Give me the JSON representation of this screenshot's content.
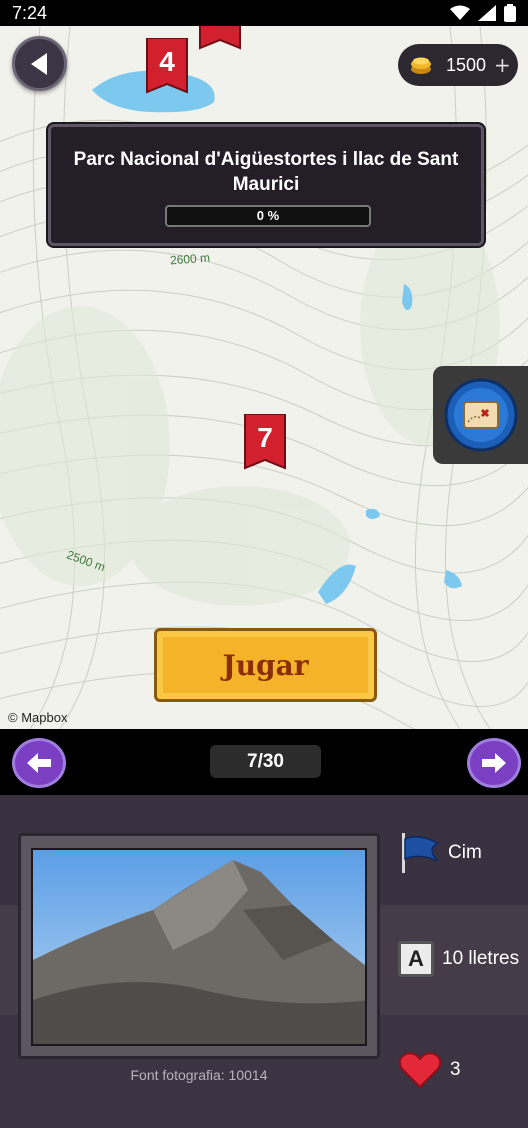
{
  "statusbar": {
    "time": "7:24"
  },
  "coins": {
    "value": "1500",
    "plus": "+"
  },
  "park": {
    "title": "Parc Nacional d'Aigüestortes i llac de Sant Maurici",
    "progress_text": "0 %",
    "progress": 0
  },
  "markers": [
    {
      "number": "4"
    },
    {
      "number": "7"
    }
  ],
  "contours": {
    "label_a": "2600 m",
    "label_b": "2500 m"
  },
  "play_button": {
    "label": "Jugar"
  },
  "attribution": "© Mapbox",
  "pager": {
    "current": "7/30"
  },
  "details": {
    "photo_credit": "Font fotografia: 10014",
    "category": "Cim",
    "letter_box": "A",
    "letters": "10 lletres",
    "lives": "3"
  },
  "colors": {
    "purple_button": "#7b3fc4",
    "gold_button": "#f5b32a",
    "marker_red": "#d3202f",
    "panel": "#231e27"
  }
}
